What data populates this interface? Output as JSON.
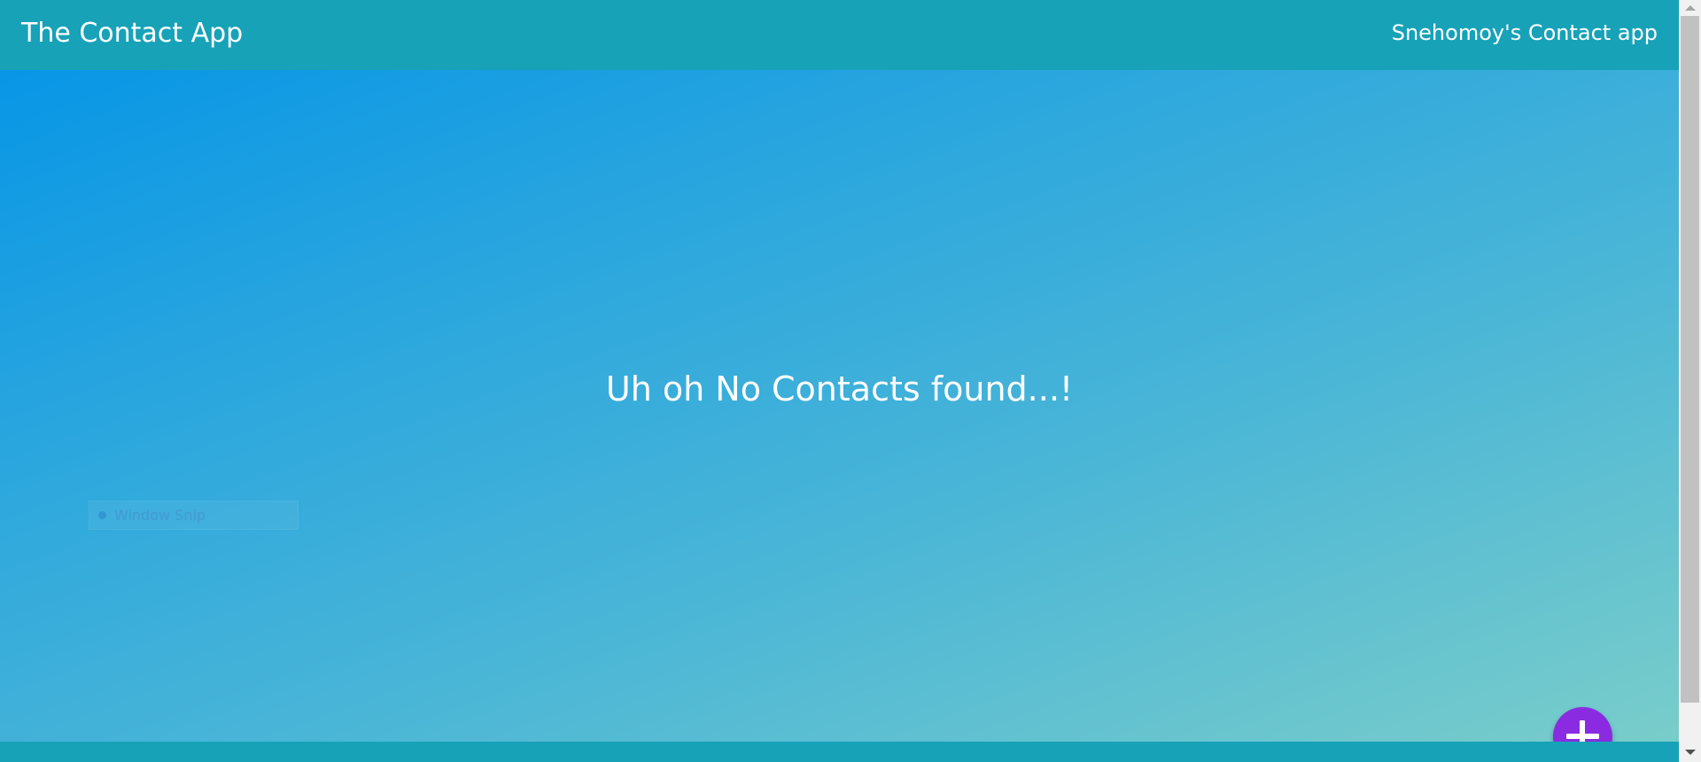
{
  "navbar": {
    "brand": "The Contact App",
    "right_text": "Snehomoy's Contact app"
  },
  "main": {
    "empty_message": "Uh oh No Contacts found...!"
  },
  "overlay": {
    "snip_label": "Window Snip"
  },
  "fab": {
    "icon": "plus-icon"
  },
  "colors": {
    "navbar": "#17a2b8",
    "fab": "#8a2be2",
    "gradient_start": "#0896e6",
    "gradient_end": "#79cdca"
  }
}
